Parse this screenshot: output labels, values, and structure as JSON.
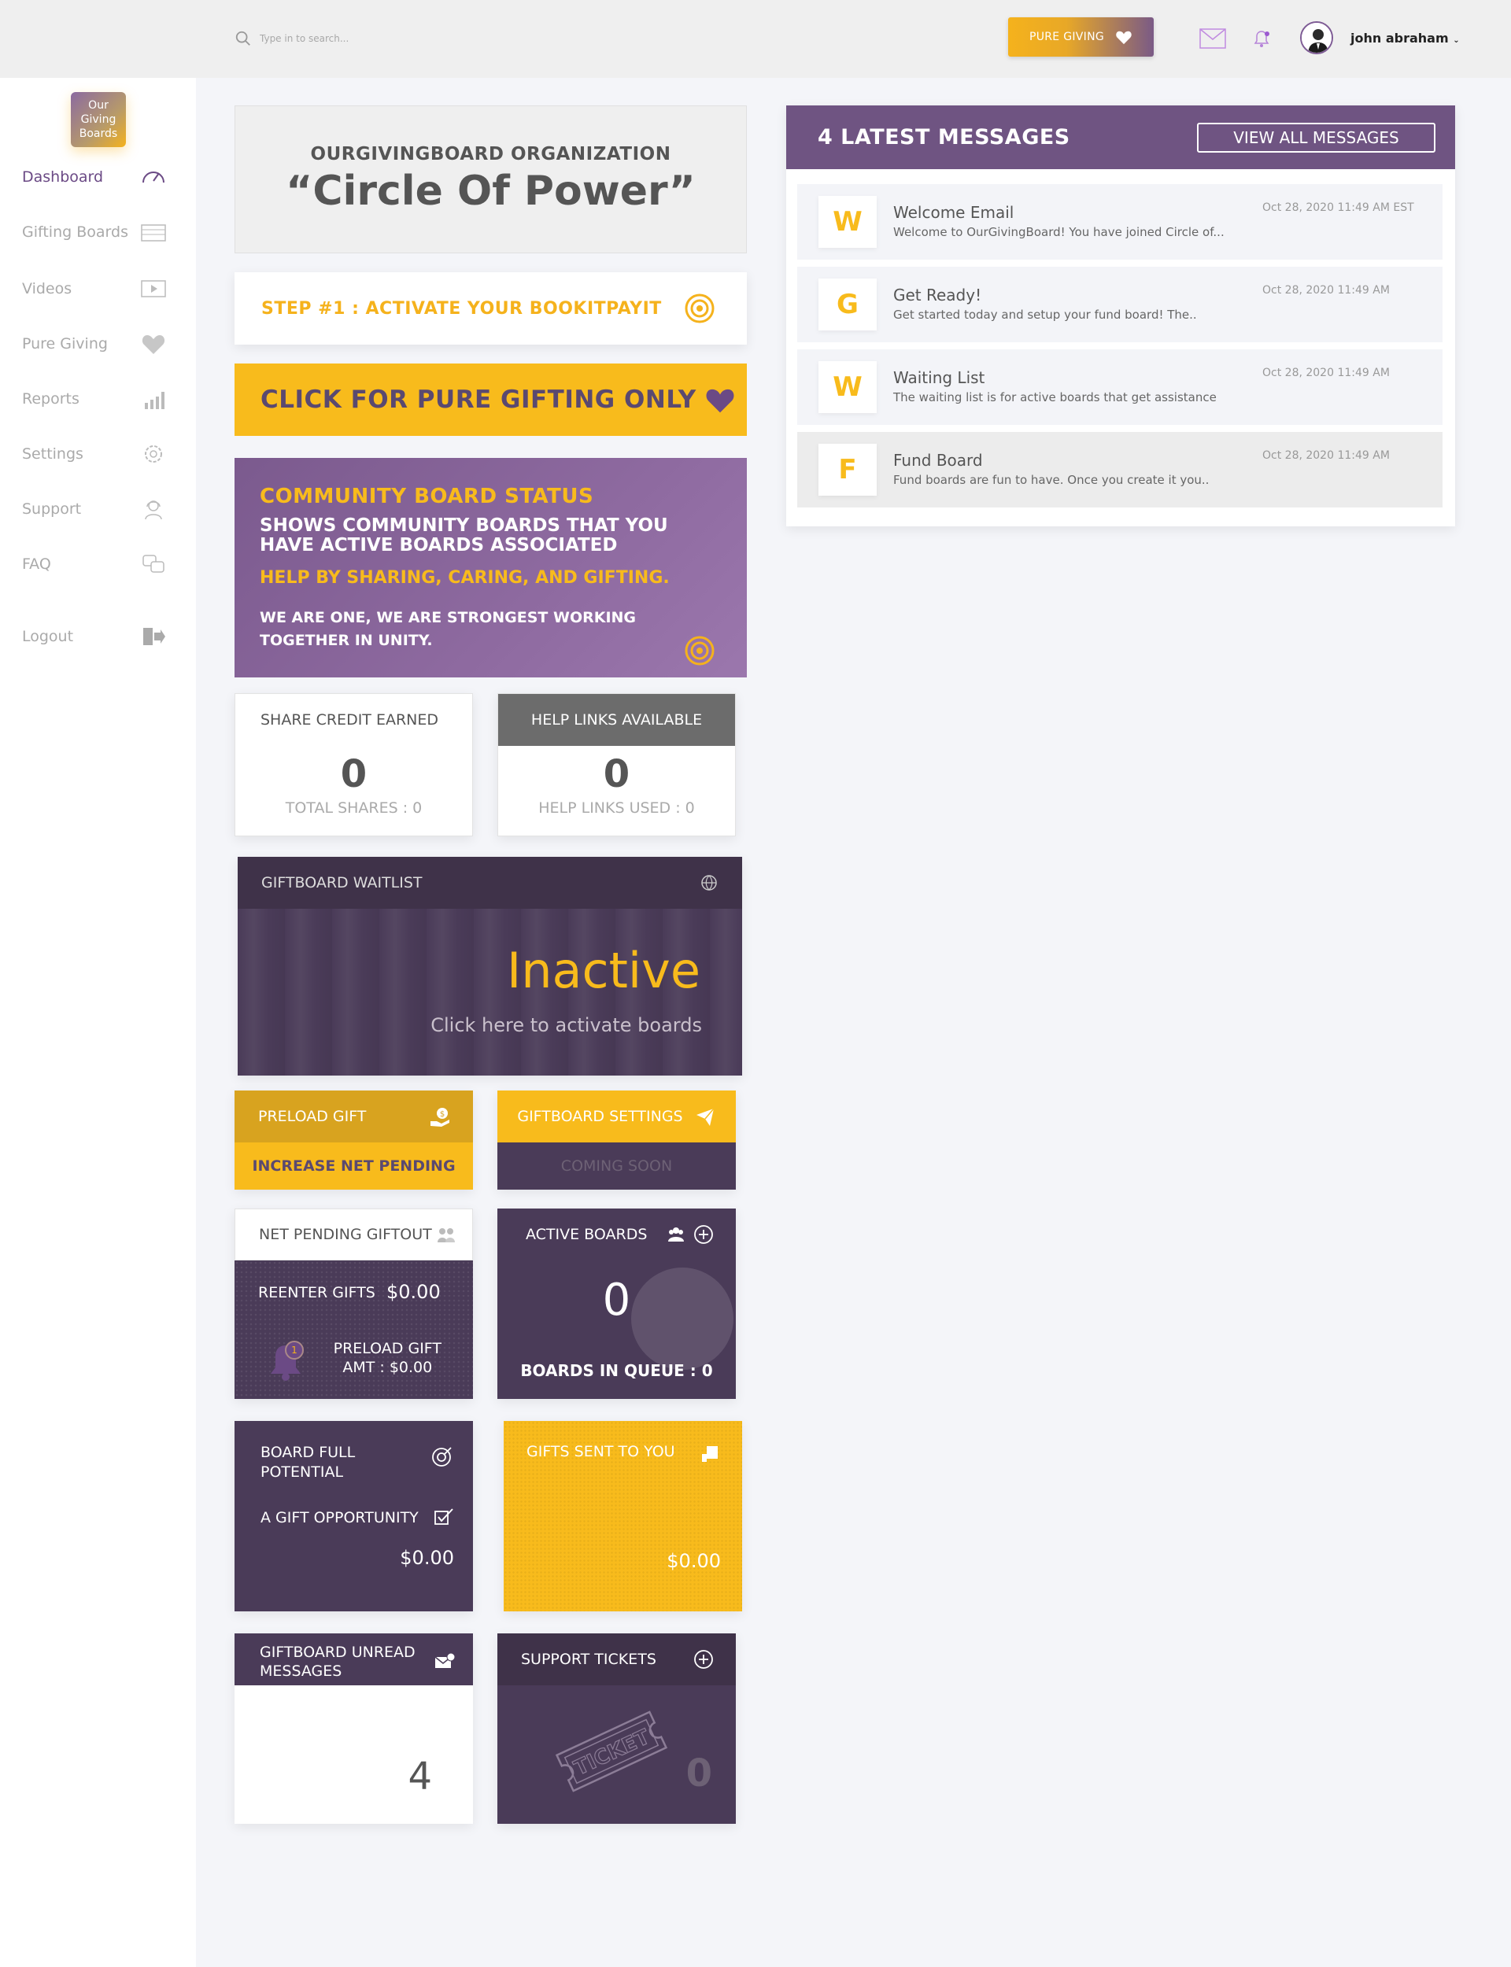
{
  "topbar": {
    "search_placeholder": "Type in to search...",
    "pure_giving_label": "PURE GIVING",
    "username": "john abraham"
  },
  "sidebar": {
    "logo_text": "Our Giving Boards",
    "items": [
      {
        "label": "Dashboard",
        "icon": "speedometer-icon"
      },
      {
        "label": "Gifting Boards",
        "icon": "boards-icon"
      },
      {
        "label": "Videos",
        "icon": "video-icon"
      },
      {
        "label": "Pure Giving",
        "icon": "heart-icon"
      },
      {
        "label": "Reports",
        "icon": "chart-icon"
      },
      {
        "label": "Settings",
        "icon": "gear-icon"
      },
      {
        "label": "Support",
        "icon": "support-icon"
      },
      {
        "label": "FAQ",
        "icon": "faq-icon"
      },
      {
        "label": "Logout",
        "icon": "logout-icon"
      }
    ]
  },
  "org": {
    "subtitle": "OURGIVINGBOARD ORGANIZATION",
    "title": "“Circle Of Power”"
  },
  "step": {
    "label": "STEP #1 : ACTIVATE YOUR BOOKITPAYIT"
  },
  "pure_gifting": {
    "label": "CLICK FOR PURE GIFTING ONLY"
  },
  "community": {
    "title": "COMMUNITY BOARD STATUS",
    "line1": "SHOWS COMMUNITY BOARDS THAT YOU HAVE ACTIVE BOARDS ASSOCIATED",
    "line2": "HELP BY SHARING, CARING, AND GIFTING.",
    "line3": "WE ARE ONE, WE ARE STRONGEST WORKING TOGETHER IN UNITY."
  },
  "share_credit": {
    "title": "SHARE CREDIT EARNED",
    "value": "0",
    "sub": "TOTAL SHARES : 0"
  },
  "help_links": {
    "title": "HELP LINKS AVAILABLE",
    "value": "0",
    "sub": "HELP LINKS USED : 0"
  },
  "waitlist": {
    "title": "GIFTBOARD WAITLIST",
    "status": "Inactive",
    "link": "Click here to activate boards"
  },
  "preload": {
    "title": "PRELOAD GIFT",
    "action": "INCREASE NET PENDING"
  },
  "giftboard_settings": {
    "title": "GIFTBOARD SETTINGS",
    "status": "COMING SOON"
  },
  "net_pending": {
    "title": "NET PENDING GIFTOUT",
    "reenter_label": "REENTER GIFTS",
    "reenter_value": "$0.00",
    "badge": "1",
    "preload_line1": "PRELOAD GIFT",
    "preload_line2": "AMT : $0.00"
  },
  "active_boards": {
    "title": "ACTIVE BOARDS",
    "value": "0",
    "sub": "BOARDS IN QUEUE : 0"
  },
  "board_potential": {
    "title": "BOARD FULL POTENTIAL",
    "sub": "A GIFT OPPORTUNITY",
    "value": "$0.00"
  },
  "gifts_sent": {
    "title": "GIFTS SENT TO YOU",
    "value": "$0.00"
  },
  "unread": {
    "title": "GIFTBOARD UNREAD MESSAGES",
    "value": "4"
  },
  "support_tickets": {
    "title": "SUPPORT TICKETS",
    "value": "0",
    "ticket_text": "TICKET"
  },
  "messages": {
    "title": "4 LATEST MESSAGES",
    "view_all": "VIEW ALL MESSAGES",
    "items": [
      {
        "letter": "W",
        "title": "Welcome Email",
        "preview": "Welcome to OurGivingBoard! You have joined Circle of...",
        "date": "Oct 28, 2020 11:49 AM EST"
      },
      {
        "letter": "G",
        "title": "Get Ready!",
        "preview": "Get started today and setup your fund board! The..",
        "date": "Oct 28, 2020 11:49 AM"
      },
      {
        "letter": "W",
        "title": "Waiting List",
        "preview": "The waiting list is for active boards that get assistance",
        "date": "Oct 28, 2020 11:49 AM"
      },
      {
        "letter": "F",
        "title": "Fund Board",
        "preview": "Fund boards are fun to have. Once you create it you..",
        "date": "Oct 28, 2020 11:49 AM"
      }
    ]
  },
  "colors": {
    "accent_yellow": "#f8bb1c",
    "accent_purple": "#6f5482",
    "dark_purple": "#4a3b58"
  }
}
